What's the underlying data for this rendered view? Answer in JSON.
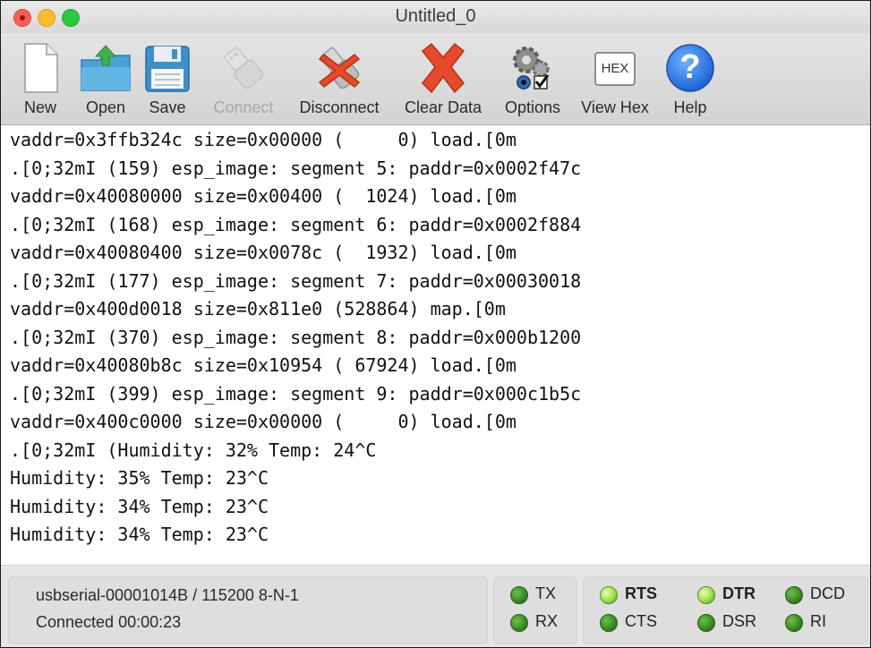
{
  "window": {
    "title": "Untitled_0"
  },
  "toolbar": {
    "new": "New",
    "open": "Open",
    "save": "Save",
    "connect": "Connect",
    "disconnect": "Disconnect",
    "clear_data": "Clear Data",
    "options": "Options",
    "view_hex": "View Hex",
    "help": "Help",
    "hex_icon_text": "HEX",
    "help_icon_text": "?"
  },
  "terminal": {
    "lines": [
      "vaddr=0x3ffb324c size=0x00000 (     0) load.[0m",
      ".[0;32mI (159) esp_image: segment 5: paddr=0x0002f47c",
      "vaddr=0x40080000 size=0x00400 (  1024) load.[0m",
      ".[0;32mI (168) esp_image: segment 6: paddr=0x0002f884",
      "vaddr=0x40080400 size=0x0078c (  1932) load.[0m",
      ".[0;32mI (177) esp_image: segment 7: paddr=0x00030018",
      "vaddr=0x400d0018 size=0x811e0 (528864) map.[0m",
      ".[0;32mI (370) esp_image: segment 8: paddr=0x000b1200",
      "vaddr=0x40080b8c size=0x10954 ( 67924) load.[0m",
      ".[0;32mI (399) esp_image: segment 9: paddr=0x000c1b5c",
      "vaddr=0x400c0000 size=0x00000 (     0) load.[0m",
      ".[0;32mI (Humidity: 32% Temp: 24^C",
      "Humidity: 35% Temp: 23^C",
      "Humidity: 34% Temp: 23^C",
      "Humidity: 34% Temp: 23^C"
    ]
  },
  "status": {
    "port": "usbserial-00001014B / 115200 8-N-1",
    "connection": "Connected 00:00:23",
    "signals": {
      "tx": "TX",
      "rx": "RX",
      "rts": "RTS",
      "cts": "CTS",
      "dtr": "DTR",
      "dsr": "DSR",
      "dcd": "DCD",
      "ri": "RI"
    }
  }
}
